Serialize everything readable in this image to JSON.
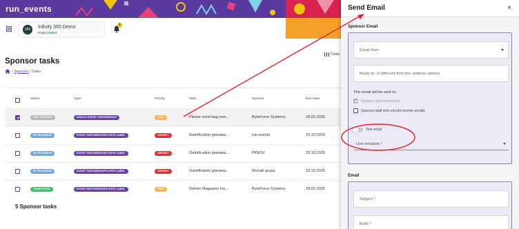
{
  "header": {
    "logo": "run_events"
  },
  "event": {
    "avatar_text": "365",
    "name": "Infinity 365 Demo",
    "status": "PUBLISHED"
  },
  "notifications": {
    "count": "1"
  },
  "page": {
    "title": "Sponsor tasks",
    "breadcrumb_link": "Sponsors",
    "breadcrumb_sep": "/",
    "breadcrumb_current": "/ Tasks",
    "columns_label": "Custo"
  },
  "table": {
    "headers": {
      "status": "Status",
      "type": "Type",
      "priority": "Priority",
      "task": "Task",
      "sponsor": "Sponsor",
      "due_date": "Due Date"
    },
    "rows": [
      {
        "checked": true,
        "status": "NOT STARTED",
        "status_color": "#b8b8b8",
        "type": "SINGLE EVENT PARTNERSHIP",
        "priority": "HIGH",
        "priority_color": "#f7b742",
        "task": "Please send bag inse...",
        "sponsor": "ByteForce Systems",
        "due_date": "28.02.2025"
      },
      {
        "checked": false,
        "status": "IN PROGRESS",
        "status_color": "#6fa7d8",
        "type": "EVENT PARTNERSHIPS WITH LABEL",
        "priority": "URGENT",
        "priority_color": "#e02d3c",
        "task": "Gamification giveawa...",
        "sponsor": "run.events",
        "due_date": "23.10.2025"
      },
      {
        "checked": false,
        "status": "IN PROGRESS",
        "status_color": "#6fa7d8",
        "type": "EVENT PARTNERSHIPS WITH LABEL",
        "priority": "URGENT",
        "priority_color": "#e02d3c",
        "task": "Gamification giveawa...",
        "sponsor": "PPEDV",
        "due_date": "23.10.2025"
      },
      {
        "checked": false,
        "status": "IN PROGRESS",
        "status_color": "#6fa7d8",
        "type": "EVENT PARTNERSHIPS WITH LABEL",
        "priority": "URGENT",
        "priority_color": "#e02d3c",
        "task": "Gamification giveawa...",
        "sponsor": "Mozaik grupa",
        "due_date": "23.10.2025"
      },
      {
        "checked": false,
        "status": "COMPLETED",
        "status_color": "#3cbf6a",
        "type": "EVENT PARTNERSHIPS WITH LABEL",
        "priority": "HIGH",
        "priority_color": "#f7b742",
        "task": "Deliver Magazine Ins...",
        "sponsor": "ByteForce Systems",
        "due_date": "28.02.2025"
      }
    ],
    "type_color": "#6a3fb0",
    "footer": "5 Sponsor tasks"
  },
  "drawer": {
    "title": "Send Email",
    "close": "×",
    "sponsor_email_title": "Sponsor Email",
    "email_from_placeholder": "Email from",
    "reply_to_placeholder": "Reply to: (if different from the address above)",
    "sent_to_label": "This email will be sent to:",
    "option_representatives": "Sponsor representatives",
    "option_staff": "Sponsor staff who should receive emails",
    "text_email_label": "Text email",
    "use_template_placeholder": "Use template *",
    "email_section_title": "Email",
    "subject_placeholder": "Subject *",
    "body_placeholder": "Body *"
  },
  "colors": {
    "brand": "#5b3aa0",
    "annotation": "#e0242b"
  }
}
